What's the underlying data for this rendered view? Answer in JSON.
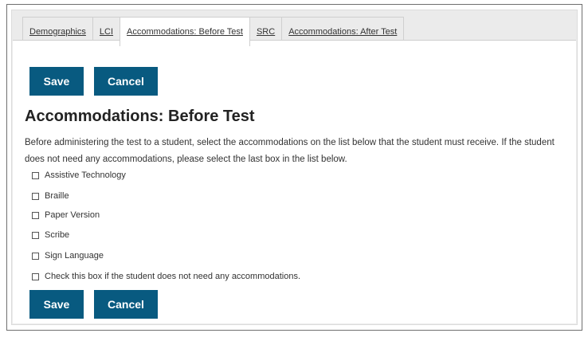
{
  "tabs": [
    {
      "label": "Demographics",
      "active": false
    },
    {
      "label": "LCI",
      "active": false
    },
    {
      "label": "Accommodations: Before Test",
      "active": true
    },
    {
      "label": "SRC",
      "active": false
    },
    {
      "label": "Accommodations: After Test",
      "active": false
    }
  ],
  "buttons": {
    "save_label": "Save",
    "cancel_label": "Cancel"
  },
  "page": {
    "title": "Accommodations: Before Test",
    "instructions": "Before administering the test to a student, select the accommodations on the list below that the student must receive. If the student does not need any accommodations, please select the last box in the list below."
  },
  "options": [
    {
      "label": "Assistive Technology",
      "checked": false
    },
    {
      "label": "Braille",
      "checked": false
    },
    {
      "label": "Paper Version",
      "checked": false
    },
    {
      "label": "Scribe",
      "checked": false
    },
    {
      "label": "Sign Language",
      "checked": false
    },
    {
      "label": "Check this box if the student does not need any accommodations.",
      "checked": false
    }
  ],
  "colors": {
    "button": "#085a80",
    "panel": "#ebebeb"
  }
}
